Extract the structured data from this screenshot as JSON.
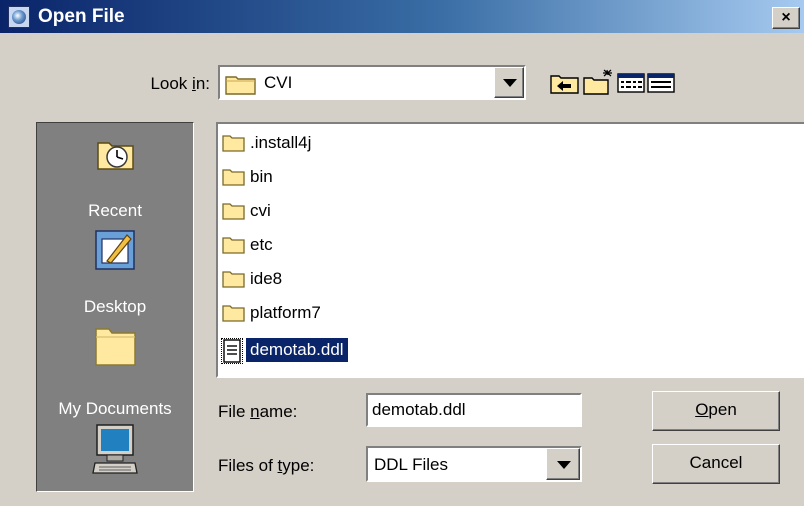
{
  "window": {
    "title": "Open File",
    "close_glyph": "×"
  },
  "lookin": {
    "label_pre": "Look ",
    "label_key": "i",
    "label_post": "n:",
    "value": "CVI",
    "toolbar": [
      "up-one-level-icon",
      "create-new-folder-icon",
      "list-view-icon",
      "details-view-icon"
    ]
  },
  "places": [
    {
      "label": "Recent",
      "icon": "recent-clock-icon"
    },
    {
      "label": "Desktop",
      "icon": "desktop-icon"
    },
    {
      "label": "My Documents",
      "icon": "my-documents-folder-icon"
    },
    {
      "label": "",
      "icon": "my-computer-icon"
    }
  ],
  "files": [
    {
      "name": ".install4j",
      "type": "folder"
    },
    {
      "name": "bin",
      "type": "folder"
    },
    {
      "name": "cvi",
      "type": "folder"
    },
    {
      "name": "etc",
      "type": "folder"
    },
    {
      "name": "ide8",
      "type": "folder"
    },
    {
      "name": "platform7",
      "type": "folder"
    },
    {
      "name": "demotab.ddl",
      "type": "file",
      "selected": true
    }
  ],
  "filename": {
    "label_pre": "File ",
    "label_key": "n",
    "label_post": "ame:",
    "value": "demotab.ddl"
  },
  "filetype": {
    "label_pre": "Files of ",
    "label_key": "t",
    "label_post": "ype:",
    "value": "DDL Files"
  },
  "buttons": {
    "open_key": "O",
    "open_rest": "pen",
    "cancel": "Cancel"
  },
  "colors": {
    "selection": "#0a246a",
    "face": "#d4d0c8",
    "places_bg": "#808080",
    "folder": "#ffe9a0"
  }
}
